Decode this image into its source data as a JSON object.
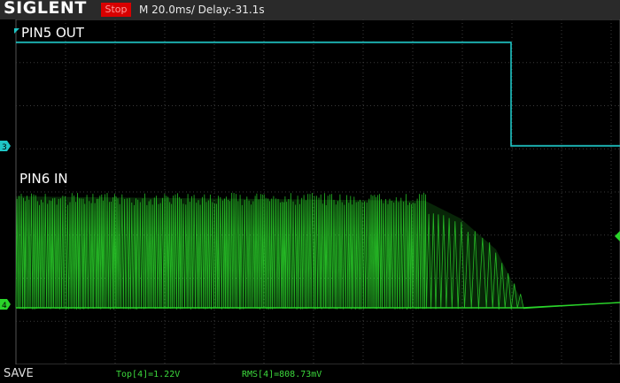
{
  "header": {
    "brand": "SIGLENT",
    "run_state": "Stop",
    "timebase": "M 20.0ms/ Delay:-31.1s"
  },
  "traces": {
    "ch3": {
      "label": "PIN5 OUT",
      "marker": "3",
      "color": "#1fc6c6"
    },
    "ch4": {
      "label": "PIN6 IN",
      "marker": "4",
      "color": "#2ad42a"
    }
  },
  "footer": {
    "save_label": "SAVE",
    "measurements": [
      {
        "text": "Top[4]=1.22V"
      },
      {
        "text": "RMS[4]=808.73mV"
      }
    ]
  }
}
